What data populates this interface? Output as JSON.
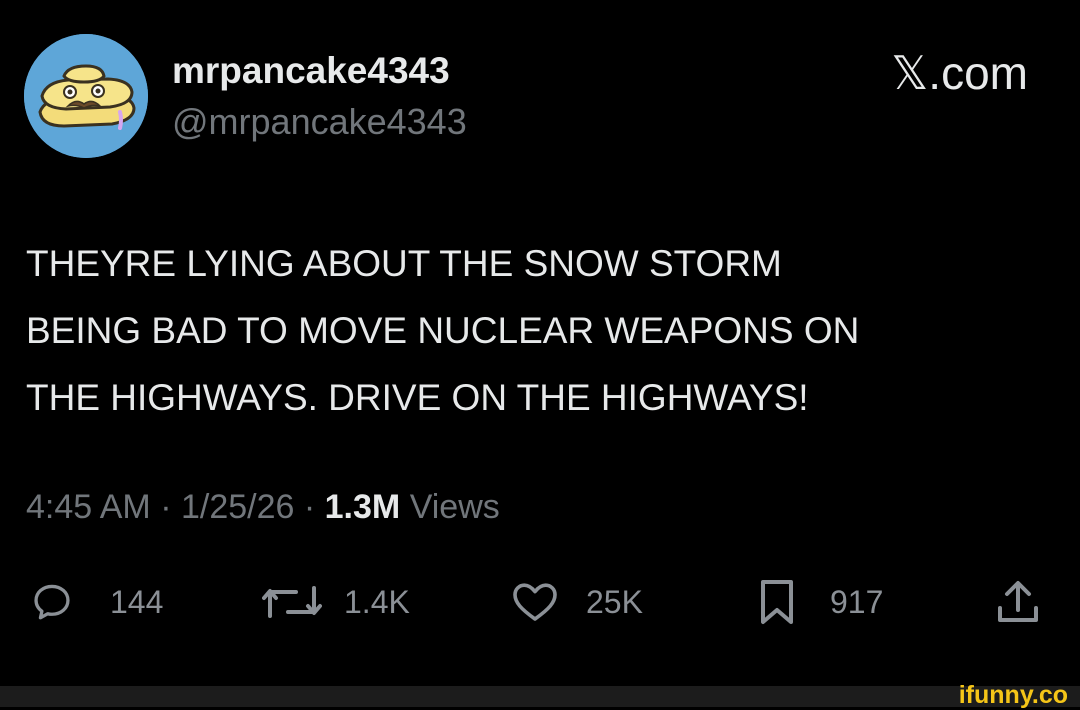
{
  "post": {
    "display_name": "mrpancake4343",
    "handle": "@mrpancake4343",
    "brand": "𝕏.com",
    "text": "THEYRE LYING ABOUT THE SNOW STORM\nBEING BAD TO MOVE NUCLEAR WEAPONS ON\nTHE HIGHWAYS. DRIVE ON THE HIGHWAYS!",
    "time": "4:45 AM",
    "date": "1/25/26",
    "views_count": "1.3M",
    "views_label": "Views",
    "separator": " · "
  },
  "actions": {
    "replies": {
      "icon": "reply-icon",
      "count": "144"
    },
    "reposts": {
      "icon": "repost-icon",
      "count": "1.4K"
    },
    "likes": {
      "icon": "heart-icon",
      "count": "25K"
    },
    "bookmarks": {
      "icon": "bookmark-icon",
      "count": "917"
    },
    "share": {
      "icon": "share-icon"
    }
  },
  "watermark": "ifunny.co",
  "colors": {
    "background": "#000000",
    "primary_text": "#e7e9ea",
    "secondary_text": "#71767b",
    "avatar_bg": "#5ea6d8",
    "watermark": "#f5c518"
  }
}
